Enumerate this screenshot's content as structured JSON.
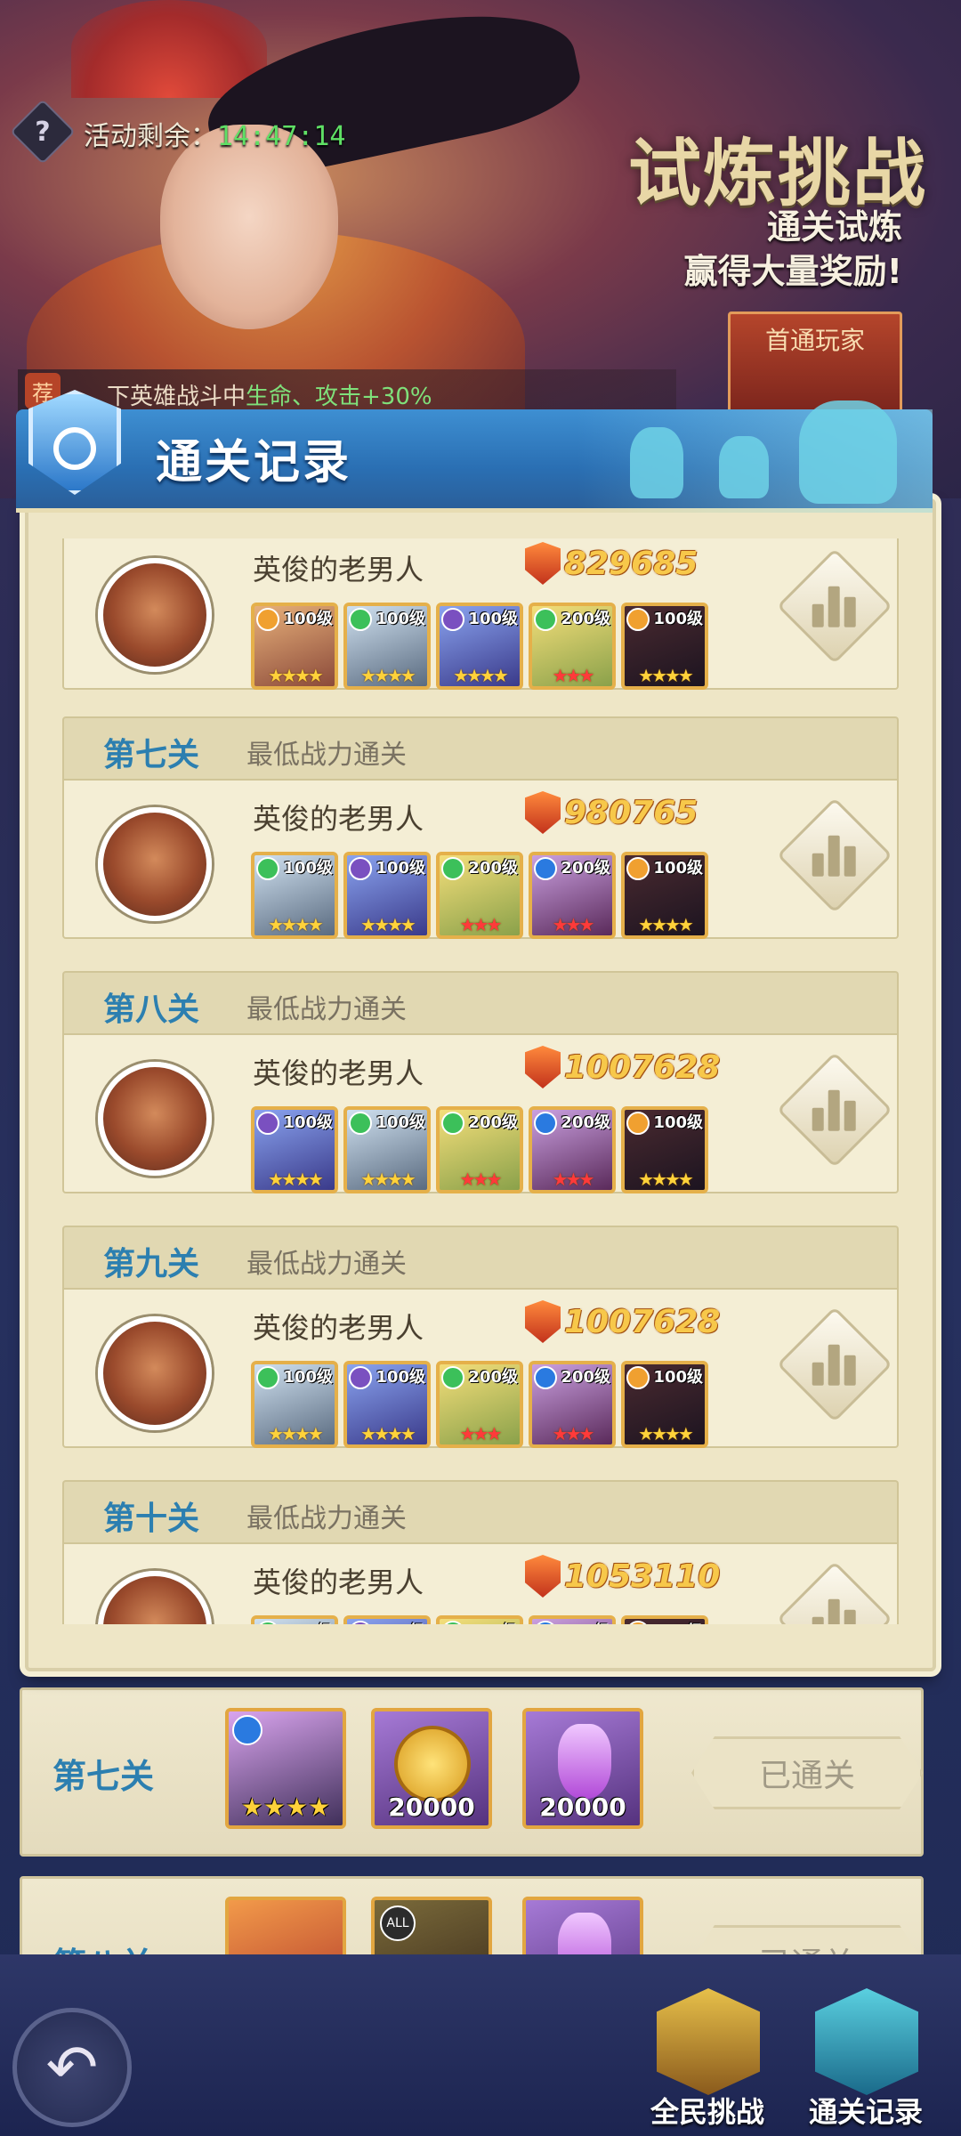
{
  "event": {
    "timer_label": "活动剩余：",
    "timer_value": "14:47:14",
    "title": "试炼挑战",
    "subtitle_line1": "通关试炼",
    "subtitle_line2": "赢得大量奖励!",
    "first_clear_label": "首通玩家",
    "buff_tag": "荐",
    "buff_text_prefix": "下英雄战斗中",
    "buff_text_highlight": "生命、攻击+30%"
  },
  "modal": {
    "title": "通关记录",
    "sections": [
      {
        "stage": "",
        "desc": "",
        "player": "英俊的老男人",
        "power": "829685",
        "heroes": [
          {
            "level": "100级",
            "element": "light",
            "stars": "★★★★",
            "red": false,
            "tone": "c1"
          },
          {
            "level": "100级",
            "element": "wind",
            "stars": "★★★★",
            "red": false,
            "tone": "c2"
          },
          {
            "level": "100级",
            "element": "dark",
            "stars": "★★★★",
            "red": false,
            "tone": "c3"
          },
          {
            "level": "200级",
            "element": "wind",
            "stars": "★★★",
            "red": true,
            "tone": "c4"
          },
          {
            "level": "100级",
            "element": "light",
            "stars": "★★★★",
            "red": false,
            "tone": "c5"
          }
        ]
      },
      {
        "stage": "第七关",
        "desc": "最低战力通关",
        "player": "英俊的老男人",
        "power": "980765",
        "heroes": [
          {
            "level": "100级",
            "element": "wind",
            "stars": "★★★★",
            "red": false,
            "tone": "c2"
          },
          {
            "level": "100级",
            "element": "dark",
            "stars": "★★★★",
            "red": false,
            "tone": "c3"
          },
          {
            "level": "200级",
            "element": "wind",
            "stars": "★★★",
            "red": true,
            "tone": "c4"
          },
          {
            "level": "200级",
            "element": "water",
            "stars": "★★★",
            "red": true,
            "tone": "c6"
          },
          {
            "level": "100级",
            "element": "light",
            "stars": "★★★★",
            "red": false,
            "tone": "c5"
          }
        ]
      },
      {
        "stage": "第八关",
        "desc": "最低战力通关",
        "player": "英俊的老男人",
        "power": "1007628",
        "heroes": [
          {
            "level": "100级",
            "element": "dark",
            "stars": "★★★★",
            "red": false,
            "tone": "c3"
          },
          {
            "level": "100级",
            "element": "wind",
            "stars": "★★★★",
            "red": false,
            "tone": "c2"
          },
          {
            "level": "200级",
            "element": "wind",
            "stars": "★★★",
            "red": true,
            "tone": "c4"
          },
          {
            "level": "200级",
            "element": "water",
            "stars": "★★★",
            "red": true,
            "tone": "c6"
          },
          {
            "level": "100级",
            "element": "light",
            "stars": "★★★★",
            "red": false,
            "tone": "c5"
          }
        ]
      },
      {
        "stage": "第九关",
        "desc": "最低战力通关",
        "player": "英俊的老男人",
        "power": "1007628",
        "heroes": [
          {
            "level": "100级",
            "element": "wind",
            "stars": "★★★★",
            "red": false,
            "tone": "c2"
          },
          {
            "level": "100级",
            "element": "dark",
            "stars": "★★★★",
            "red": false,
            "tone": "c3"
          },
          {
            "level": "200级",
            "element": "wind",
            "stars": "★★★",
            "red": true,
            "tone": "c4"
          },
          {
            "level": "200级",
            "element": "water",
            "stars": "★★★",
            "red": true,
            "tone": "c6"
          },
          {
            "level": "100级",
            "element": "light",
            "stars": "★★★★",
            "red": false,
            "tone": "c5"
          }
        ]
      },
      {
        "stage": "第十关",
        "desc": "最低战力通关",
        "player": "英俊的老男人",
        "power": "1053110",
        "heroes": [
          {
            "level": "100级",
            "element": "wind",
            "stars": "★★★★",
            "red": false,
            "tone": "c2"
          },
          {
            "level": "100级",
            "element": "dark",
            "stars": "★★★★",
            "red": false,
            "tone": "c3"
          },
          {
            "level": "200级",
            "element": "wind",
            "stars": "★★★",
            "red": true,
            "tone": "c4"
          },
          {
            "level": "200级",
            "element": "water",
            "stars": "★★★",
            "red": true,
            "tone": "c6"
          },
          {
            "level": "100级",
            "element": "light",
            "stars": "★★★★",
            "red": false,
            "tone": "c5"
          }
        ]
      }
    ]
  },
  "stage_rows": [
    {
      "stage": "第七关",
      "reward_stars": "★★★★",
      "coin_count": "20000",
      "potion_count": "20000",
      "status": "已通关"
    },
    {
      "stage": "第八关",
      "tag": "ALL",
      "status": "已通关"
    }
  ],
  "nav": {
    "back_icon": "↶",
    "all_challenge": "全民挑战",
    "clear_record": "通关记录"
  }
}
